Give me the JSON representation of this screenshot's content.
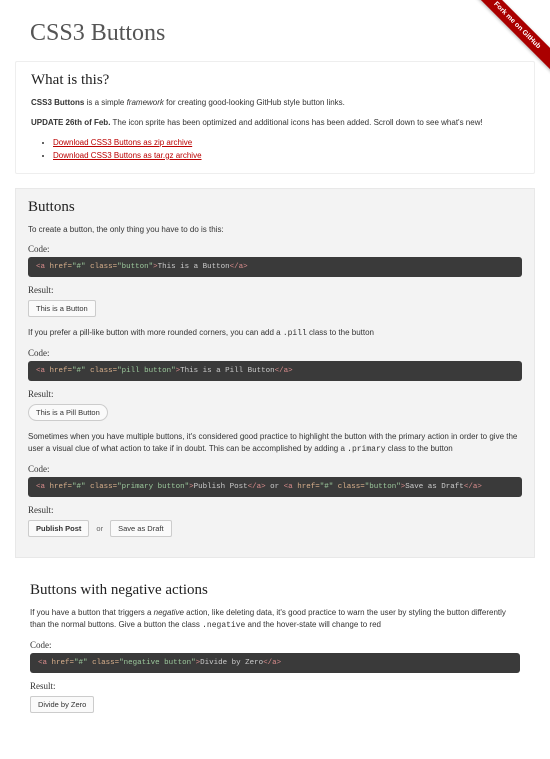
{
  "ribbon": "Fork me on GitHub",
  "title": "CSS3 Buttons",
  "intro": {
    "heading": "What is this?",
    "p1_b": "CSS3 Buttons",
    "p1_mid": " is a simple ",
    "p1_em": "framework",
    "p1_end": " for creating good-looking GitHub style button links.",
    "p2_b": "UPDATE 26th of Feb.",
    "p2_end": " The icon sprite has been optimized and additional icons has been added. Scroll down to see what's new!",
    "links": [
      "Download CSS3 Buttons as zip archive",
      "Download CSS3 Buttons as tar.gz archive"
    ]
  },
  "buttons": {
    "heading": "Buttons",
    "desc1": "To create a button, the only thing you have to do is this:",
    "codeLabel": "Code:",
    "resultLabel": "Result:",
    "btn1": "This is a Button",
    "desc2_pre": "If you prefer a pill-like button with more rounded corners, you can add a ",
    "desc2_code": ".pill",
    "desc2_post": " class to the button",
    "btn2": "This is a Pill Button",
    "desc3_pre": "Sometimes when you have multiple buttons, it's considered good practice to highlight the button with the primary action in order to give the user a visual clue of what action to take if in doubt. This can be accomplished by adding a ",
    "desc3_code": ".primary",
    "desc3_post": " class to the button",
    "btn3a": "Publish Post",
    "btn3or": "or",
    "btn3b": "Save as Draft"
  },
  "negative": {
    "heading": "Buttons with negative actions",
    "desc_pre": "If you have a button that triggers a ",
    "desc_em": "negative",
    "desc_mid": " action, like deleting data, it's good practice to warn the user by styling the button differently than the normal buttons. Give a button the class ",
    "desc_code": ".negative",
    "desc_post": " and the hover-state will change to red",
    "btn": "Divide by Zero"
  }
}
